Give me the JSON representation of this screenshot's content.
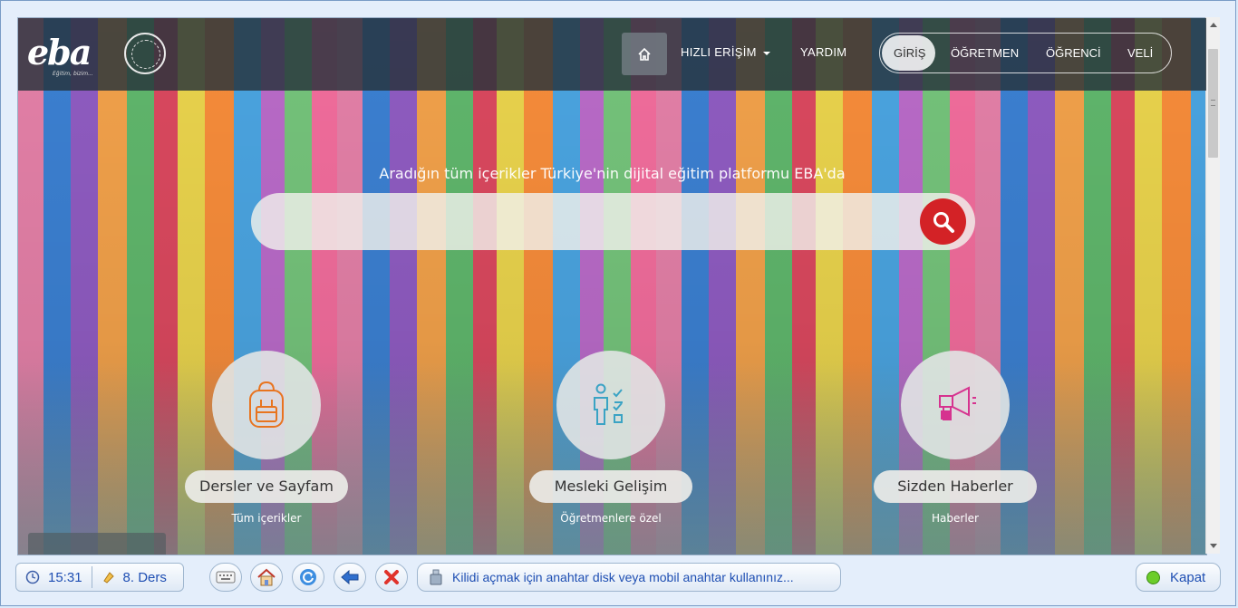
{
  "browser": {
    "header": {
      "logo": "eba",
      "logo_sub": "Eğitim, bizim...",
      "nav": {
        "home_icon": "home-icon",
        "quick_access": "HIZLI ERİŞİM",
        "help": "YARDIM"
      },
      "auth": {
        "login": "GİRİŞ",
        "teacher": "ÖĞRETMEN",
        "student": "ÖĞRENCİ",
        "parent": "VELİ"
      }
    },
    "hero": {
      "tagline": "Aradığın tüm içerikler Türkiye'nin dijital eğitim platformu EBA'da",
      "search_value": "",
      "search_icon": "search-icon"
    },
    "features": [
      {
        "title": "Dersler ve Sayfam",
        "subtitle": "Tüm içerikler",
        "icon": "backpack-icon",
        "color": "#e8741f"
      },
      {
        "title": "Mesleki Gelişim",
        "subtitle": "Öğretmenlere özel",
        "icon": "person-checklist-icon",
        "color": "#3aa3c4"
      },
      {
        "title": "Sizden Haberler",
        "subtitle": "Haberler",
        "icon": "megaphone-icon",
        "color": "#d6338f"
      }
    ]
  },
  "taskbar": {
    "time": "15:31",
    "lesson": "8. Ders",
    "lock_message": "Kilidi açmak için anahtar disk veya mobil anahtar kullanınız...",
    "close_label": "Kapat",
    "accent": "#1f4fb3"
  }
}
